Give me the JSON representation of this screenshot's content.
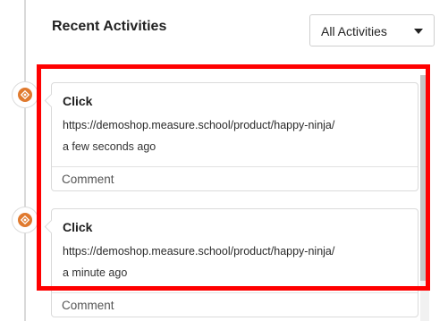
{
  "header": {
    "title": "Recent Activities",
    "filter": {
      "selected": "All Activities"
    }
  },
  "activities": [
    {
      "type": "Click",
      "url": "https://demoshop.measure.school/product/happy-ninja/",
      "time": "a few seconds ago",
      "comment_placeholder": "Comment"
    },
    {
      "type": "Click",
      "url": "https://demoshop.measure.school/product/happy-ninja/",
      "time": "a minute ago",
      "comment_placeholder": "Comment"
    }
  ],
  "colors": {
    "marker": "#e07a2f",
    "highlight": "#ff0000"
  }
}
